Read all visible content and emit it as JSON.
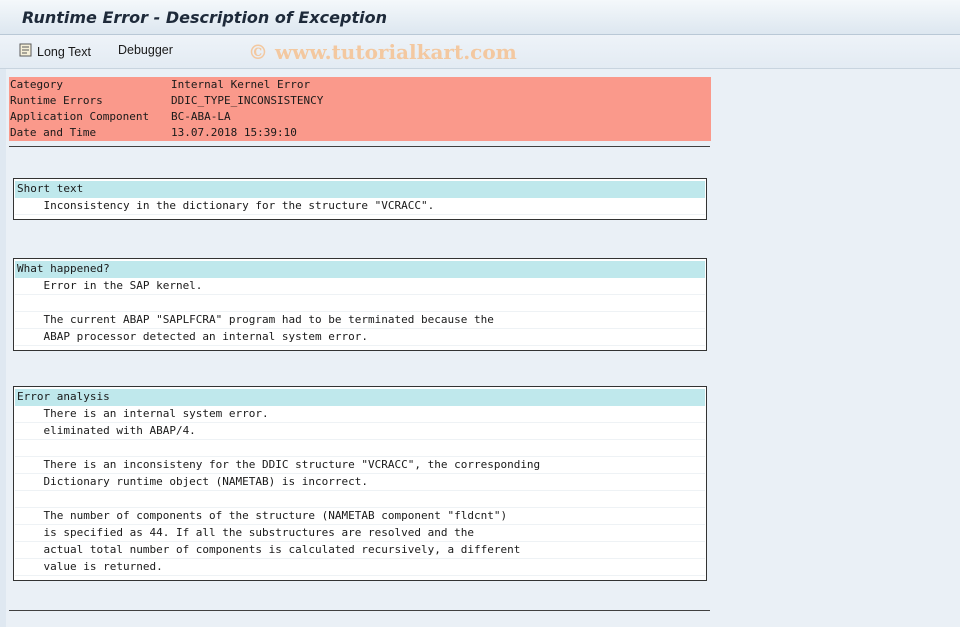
{
  "window": {
    "title": "Runtime Error - Description of Exception"
  },
  "toolbar": {
    "long_text_label": "Long Text",
    "debugger_label": "Debugger",
    "watermark": "© www.tutorialkart.com"
  },
  "header_info": [
    {
      "key": "Category",
      "value": "Internal Kernel Error"
    },
    {
      "key": "Runtime Errors",
      "value": "DDIC_TYPE_INCONSISTENCY"
    },
    {
      "key": "Application Component",
      "value": "BC-ABA-LA"
    },
    {
      "key": "Date and Time",
      "value": "13.07.2018 15:39:10"
    }
  ],
  "sections": {
    "short_text": {
      "title": "Short text",
      "lines": [
        "    Inconsistency in the dictionary for the structure \"VCRACC\"."
      ]
    },
    "what_happened": {
      "title": "What happened?",
      "lines": [
        "    Error in the SAP kernel.",
        "",
        "    The current ABAP \"SAPLFCRA\" program had to be terminated because the",
        "    ABAP processor detected an internal system error."
      ]
    },
    "error_analysis": {
      "title": "Error analysis",
      "lines": [
        "    There is an internal system error.",
        "    eliminated with ABAP/4.",
        "",
        "    There is an inconsisteny for the DDIC structure \"VCRACC\", the corresponding",
        "    Dictionary runtime object (NAMETAB) is incorrect.",
        "",
        "    The number of components of the structure (NAMETAB component \"fldcnt\")",
        "    is specified as 44. If all the substructures are resolved and the",
        "    actual total number of components is calculated recursively, a different",
        "    value is returned."
      ]
    }
  },
  "colors": {
    "header_row_bg": "#fa998b",
    "section_title_bg": "#bfe8ec",
    "background": "#dfe8f1"
  }
}
